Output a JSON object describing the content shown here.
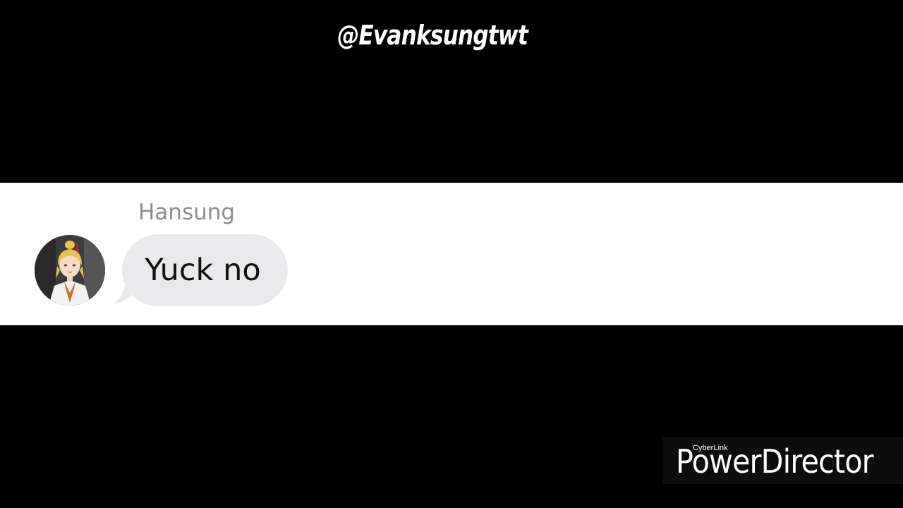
{
  "handle": "@Evanksungtwt",
  "chat": {
    "sender_name": "Hansung",
    "message": "Yuck no",
    "bubble_color": "#e9e9eb",
    "name_color": "#8e8e8e"
  },
  "avatar": {
    "icon": "anime-character-avatar"
  },
  "watermark": {
    "brand": "CyberLink",
    "product": "PowerDirector"
  }
}
